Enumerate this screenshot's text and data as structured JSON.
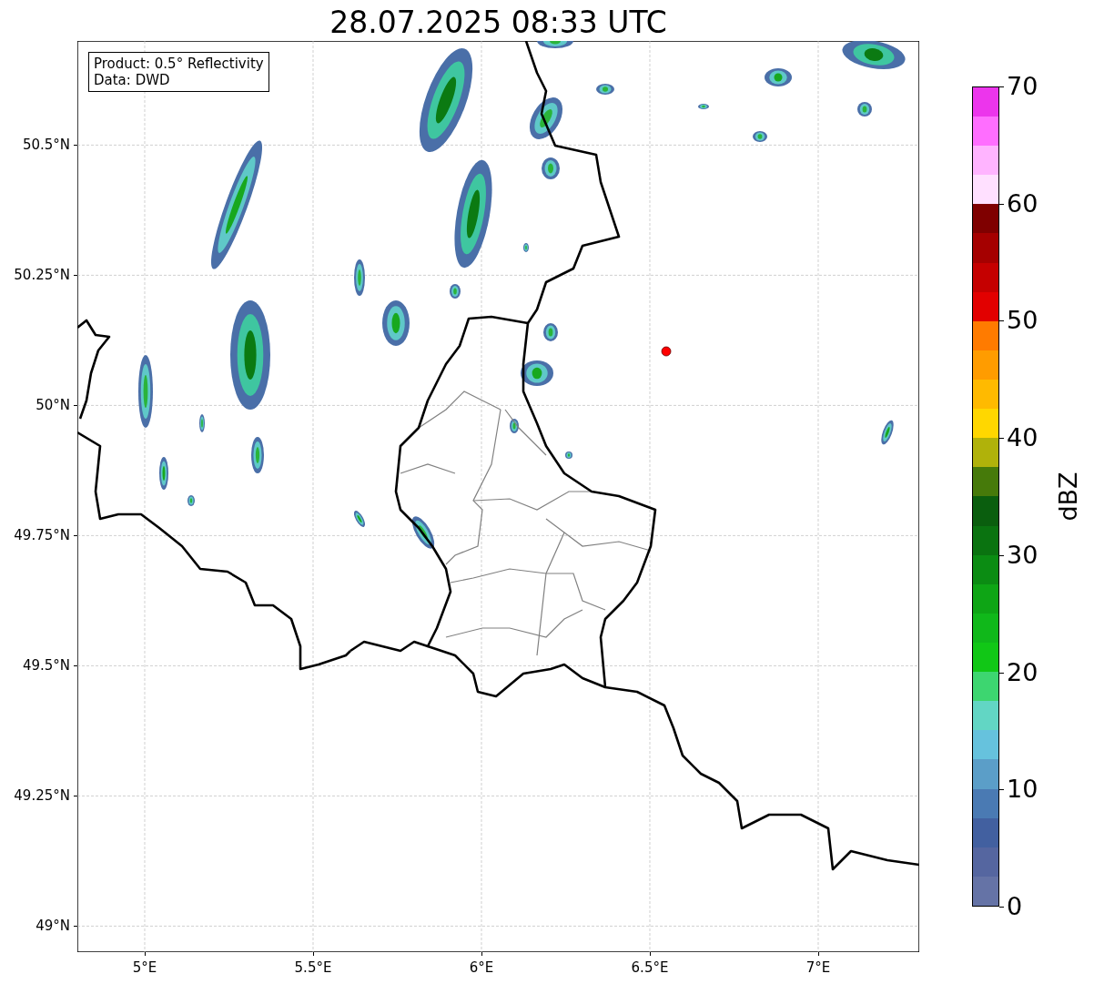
{
  "title": "28.07.2025 08:33 UTC",
  "map": {
    "xticks": [
      "5°E",
      "5.5°E",
      "6°E",
      "6.5°E",
      "7°E"
    ],
    "yticks": [
      "50.5°N",
      "50.25°N",
      "50°N",
      "49.75°N",
      "49.5°N",
      "49.25°N",
      "49°N"
    ],
    "legend": [
      "Product: 0.5° Reflectivity",
      "Data: DWD"
    ]
  },
  "colorbar": {
    "label": "dBZ",
    "segments": [
      {
        "color": "#6573a6"
      },
      {
        "color": "#5566a0"
      },
      {
        "color": "#4260a0"
      },
      {
        "color": "#4a7ab3"
      },
      {
        "color": "#5b9ec8"
      },
      {
        "color": "#66c2dd"
      },
      {
        "color": "#62d6c4"
      },
      {
        "color": "#3dd670"
      },
      {
        "color": "#11c716"
      },
      {
        "color": "#10b81a"
      },
      {
        "color": "#0ea515"
      },
      {
        "color": "#0b8c13"
      },
      {
        "color": "#0a7310"
      },
      {
        "color": "#0a5e0e"
      },
      {
        "color": "#467a0a"
      },
      {
        "color": "#b0b20a"
      },
      {
        "color": "#ffd700"
      },
      {
        "color": "#ffba00"
      },
      {
        "color": "#ff9c00"
      },
      {
        "color": "#ff7b00"
      },
      {
        "color": "#e20000"
      },
      {
        "color": "#c50000"
      },
      {
        "color": "#a50000"
      },
      {
        "color": "#7f0000"
      },
      {
        "color": "#ffe0ff"
      },
      {
        "color": "#ffb4ff"
      },
      {
        "color": "#ff6eff"
      },
      {
        "color": "#ec35ec"
      }
    ],
    "ticks": [
      "70",
      "60",
      "50",
      "40",
      "30",
      "20",
      "10",
      "0"
    ]
  }
}
